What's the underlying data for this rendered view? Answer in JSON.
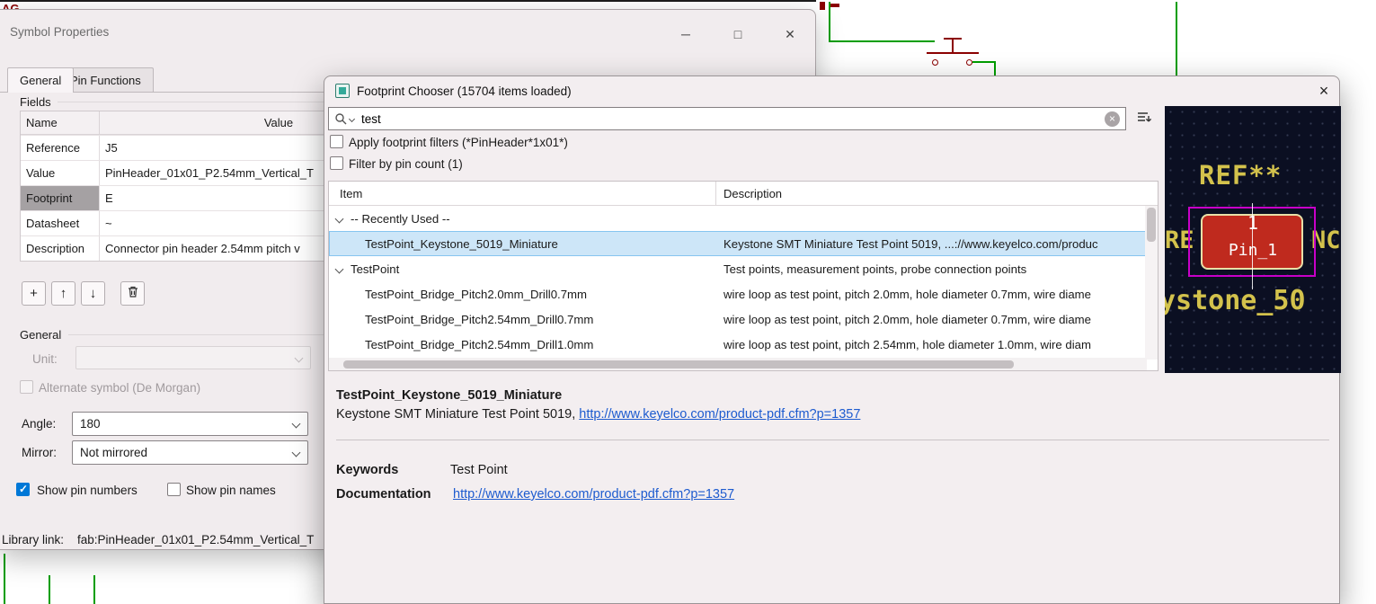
{
  "schematic": {
    "corner_text": "AG"
  },
  "colors": {
    "selection_blue": "#cde6f8",
    "link_blue": "#1d5bcf",
    "checkbox_accent": "#0078d7",
    "wire_green": "#009e00",
    "symbol_maroon": "#8b0000",
    "pad_red": "#bf2a1e",
    "courtyard_magenta": "#c800c8",
    "silkscreen_yellow": "#d3c24c",
    "preview_background": "#0b0f22"
  },
  "symbol_properties": {
    "title": "Symbol Properties",
    "window_icons": {
      "minimize": "─",
      "maximize": "□",
      "close": "✕"
    },
    "tabs": {
      "general": "General",
      "pin_functions": "Pin Functions"
    },
    "fields": {
      "group_label": "Fields",
      "columns": {
        "name": "Name",
        "value": "Value"
      },
      "rows": [
        {
          "name": "Reference",
          "value": "J5"
        },
        {
          "name": "Value",
          "value": "PinHeader_01x01_P2.54mm_Vertical_T"
        },
        {
          "name": "Footprint",
          "value": "E"
        },
        {
          "name": "Datasheet",
          "value": "~"
        },
        {
          "name": "Description",
          "value": "Connector pin header 2.54mm pitch v"
        }
      ]
    },
    "field_buttons": {
      "add": "+",
      "move_up": "↑",
      "move_down": "↓"
    },
    "general": {
      "group_label": "General",
      "unit_label": "Unit:",
      "alternate_symbol_label": "Alternate symbol (De Morgan)",
      "angle_label": "Angle:",
      "angle_value": "180",
      "mirror_label": "Mirror:",
      "mirror_value": "Not mirrored",
      "show_pin_numbers_label": "Show pin numbers",
      "show_pin_names_label": "Show pin names"
    },
    "library_link_label": "Library link:",
    "library_link_value": "fab:PinHeader_01x01_P2.54mm_Vertical_T"
  },
  "footprint_chooser": {
    "title": "Footprint Chooser (15704 items loaded)",
    "close_icon": "×",
    "search": {
      "value": "test",
      "clear_icon": "×"
    },
    "filters": {
      "footprint_filter_label": "Apply footprint filters (*PinHeader*1x01*)",
      "pin_count_label": "Filter by pin count (1)"
    },
    "list": {
      "columns": {
        "item": "Item",
        "description": "Description"
      },
      "rows": [
        {
          "item": "-- Recently Used --",
          "description": ""
        },
        {
          "item": "TestPoint_Keystone_5019_Miniature",
          "description": "Keystone SMT Miniature Test Point 5019, ...://www.keyelco.com/produc"
        },
        {
          "item": "TestPoint",
          "description": "Test points, measurement points, probe connection points"
        },
        {
          "item": "TestPoint_Bridge_Pitch2.0mm_Drill0.7mm",
          "description": "wire loop as test point, pitch 2.0mm, hole diameter 0.7mm, wire diame"
        },
        {
          "item": "TestPoint_Bridge_Pitch2.54mm_Drill0.7mm",
          "description": "wire loop as test point, pitch 2.0mm, hole diameter 0.7mm, wire diame"
        },
        {
          "item": "TestPoint_Bridge_Pitch2.54mm_Drill1.0mm",
          "description": "wire loop as test point, pitch 2.54mm, hole diameter 1.0mm, wire diam"
        }
      ]
    },
    "details": {
      "name": "TestPoint_Keystone_5019_Miniature",
      "description_prefix": "Keystone SMT Miniature Test Point 5019, ",
      "description_link": "http://www.keyelco.com/product-pdf.cfm?p=1357",
      "keywords_label": "Keywords",
      "keywords_value": "Test Point",
      "documentation_label": "Documentation",
      "documentation_link": "http://www.keyelco.com/product-pdf.cfm?p=1357"
    },
    "preview": {
      "reference": "REF**",
      "pad_number": "1",
      "pad_name": "Pin_1",
      "text_fragment_left": "RE",
      "text_fragment_right": "NC",
      "footprint_name_fragment": "ystone_50"
    }
  }
}
